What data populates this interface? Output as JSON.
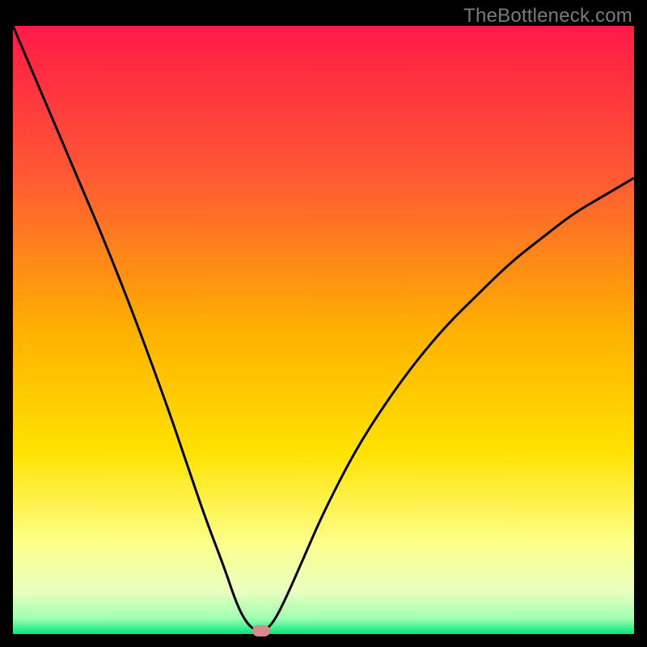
{
  "watermark": "TheBottleneck.com",
  "chart_data": {
    "type": "line",
    "title": "",
    "xlabel": "",
    "ylabel": "",
    "xlim": [
      0,
      100
    ],
    "ylim": [
      0,
      100
    ],
    "gradient_stops": [
      {
        "offset": 0.0,
        "color": "#ff1a47"
      },
      {
        "offset": 0.25,
        "color": "#ff5a33"
      },
      {
        "offset": 0.5,
        "color": "#ffb000"
      },
      {
        "offset": 0.7,
        "color": "#ffe200"
      },
      {
        "offset": 0.85,
        "color": "#fdff8a"
      },
      {
        "offset": 0.93,
        "color": "#eaffc0"
      },
      {
        "offset": 0.975,
        "color": "#9cffb1"
      },
      {
        "offset": 1.0,
        "color": "#00e57a"
      }
    ],
    "series": [
      {
        "name": "bottleneck-curve",
        "x": [
          0,
          5,
          10,
          15,
          20,
          25,
          28,
          31,
          34,
          36,
          37.5,
          39,
          40.5,
          42,
          44,
          47,
          50,
          55,
          60,
          65,
          70,
          75,
          80,
          85,
          90,
          95,
          100
        ],
        "y": [
          100,
          88,
          76,
          64,
          51,
          37,
          28,
          19,
          11,
          5,
          2,
          0.5,
          0.5,
          2,
          6,
          13,
          20,
          30,
          38,
          45,
          51,
          56,
          61,
          65,
          69,
          72,
          75
        ]
      }
    ],
    "marker": {
      "x": 40,
      "y": 0.5,
      "color": "#d98a8a"
    }
  }
}
